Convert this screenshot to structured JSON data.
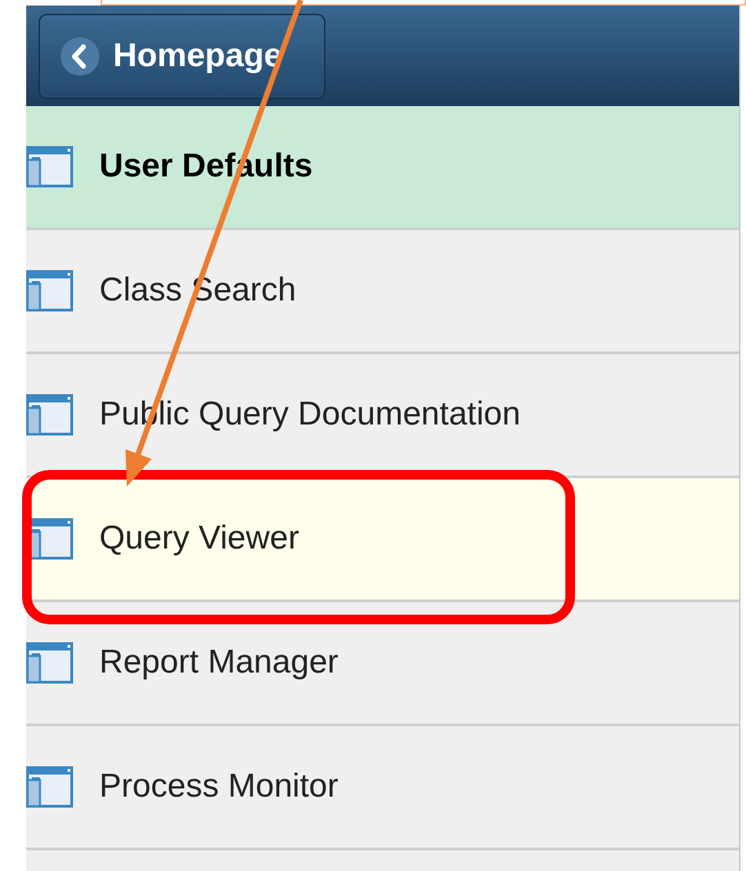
{
  "header": {
    "back_button": {
      "label": "Homepage"
    }
  },
  "menu": {
    "items": [
      {
        "label": "User Defaults",
        "selected": true,
        "highlighted": false
      },
      {
        "label": "Class Search",
        "selected": false,
        "highlighted": false
      },
      {
        "label": "Public Query Documentation",
        "selected": false,
        "highlighted": false
      },
      {
        "label": "Query Viewer",
        "selected": false,
        "highlighted": true
      },
      {
        "label": "Report Manager",
        "selected": false,
        "highlighted": false
      },
      {
        "label": "Process Monitor",
        "selected": false,
        "highlighted": false
      }
    ]
  }
}
